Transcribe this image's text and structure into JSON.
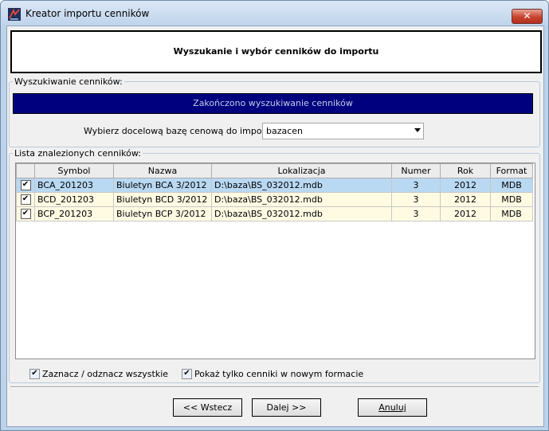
{
  "window": {
    "title": "Kreator importu cenników",
    "close_label": "✕"
  },
  "header": {
    "title": "Wyszukanie i wybór cenników do importu"
  },
  "search_group": {
    "legend": "Wyszukiwanie cenników:",
    "status": "Zakończono wyszukiwanie cenników",
    "db_label": "Wybierz docelową bazę cenową do importu:",
    "db_value": "bazacen"
  },
  "list_group": {
    "legend": "Lista znalezionych cenników:",
    "columns": [
      "",
      "Symbol",
      "Nazwa",
      "Lokalizacja",
      "Numer",
      "Rok",
      "Format"
    ],
    "rows": [
      {
        "checked": true,
        "symbol": "BCA_201203",
        "nazwa": "Biuletyn BCA 3/2012",
        "lokalizacja": "D:\\baza\\BS_032012.mdb",
        "numer": "3",
        "rok": "2012",
        "format": "MDB"
      },
      {
        "checked": true,
        "symbol": "BCD_201203",
        "nazwa": "Biuletyn BCD 3/2012",
        "lokalizacja": "D:\\baza\\BS_032012.mdb",
        "numer": "3",
        "rok": "2012",
        "format": "MDB"
      },
      {
        "checked": true,
        "symbol": "BCP_201203",
        "nazwa": "Biuletyn BCP 3/2012",
        "lokalizacja": "D:\\baza\\BS_032012.mdb",
        "numer": "3",
        "rok": "2012",
        "format": "MDB"
      }
    ]
  },
  "options": {
    "select_all_label": "Zaznacz / odznacz wszystkie",
    "select_all_checked": true,
    "new_format_label": "Pokaż tylko cenniki w nowym formacie",
    "new_format_checked": true
  },
  "buttons": {
    "back": "<< Wstecz",
    "next": "Dalej >>",
    "cancel": "Anuluj"
  },
  "icons": {
    "app": "app-logo-icon",
    "close": "close-icon",
    "check": "checkmark-icon"
  },
  "colors": {
    "status_bg": "#00007f",
    "selected_row": "#b9d8f2",
    "alt_row": "#fffbe3",
    "close_btn": "#c7442f"
  }
}
